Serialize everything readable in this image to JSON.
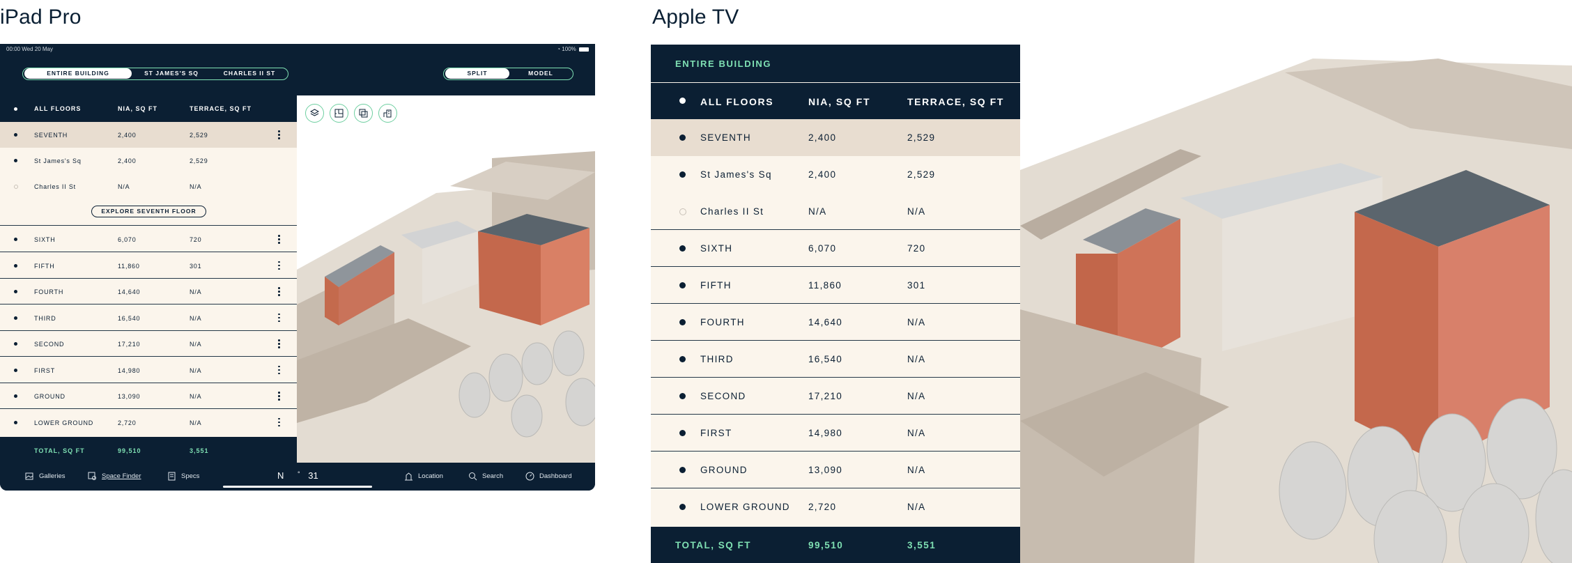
{
  "labels": {
    "ipad": "iPad Pro",
    "tv": "Apple TV"
  },
  "ipad": {
    "status": {
      "time": "00:00  Wed 20 May",
      "battery": "100%"
    },
    "building_tabs": [
      "ENTIRE BUILDING",
      "ST JAMES'S SQ",
      "CHARLES II ST"
    ],
    "active_building_tab": "ENTIRE BUILDING",
    "view_tabs": [
      "SPLIT",
      "MODEL"
    ],
    "active_view_tab": "SPLIT",
    "headers": {
      "floor": "ALL FLOORS",
      "nia": "NIA, SQ FT",
      "terrace": "TERRACE, SQ FT"
    },
    "seventh": {
      "floor": "SEVENTH",
      "nia": "2,400",
      "terrace": "2,529"
    },
    "sub_rows": [
      {
        "floor": "St James's Sq",
        "nia": "2,400",
        "terrace": "2,529"
      },
      {
        "floor": "Charles II St",
        "nia": "N/A",
        "terrace": "N/A"
      }
    ],
    "explore_button": "EXPLORE SEVENTH FLOOR",
    "rows": [
      {
        "floor": "SIXTH",
        "nia": "6,070",
        "terrace": "720"
      },
      {
        "floor": "FIFTH",
        "nia": "11,860",
        "terrace": "301"
      },
      {
        "floor": "FOURTH",
        "nia": "14,640",
        "terrace": "N/A"
      },
      {
        "floor": "THIRD",
        "nia": "16,540",
        "terrace": "N/A"
      },
      {
        "floor": "SECOND",
        "nia": "17,210",
        "terrace": "N/A"
      },
      {
        "floor": "FIRST",
        "nia": "14,980",
        "terrace": "N/A"
      },
      {
        "floor": "GROUND",
        "nia": "13,090",
        "terrace": "N/A"
      },
      {
        "floor": "LOWER GROUND",
        "nia": "2,720",
        "terrace": "N/A"
      }
    ],
    "total": {
      "label": "TOTAL, SQ FT",
      "nia": "99,510",
      "terrace": "3,551"
    },
    "tools": [
      "layers-icon",
      "floorplan-icon",
      "copy-icon",
      "building-icon"
    ],
    "tabbar": {
      "galleries": "Galleries",
      "space_finder": "Space Finder",
      "specs": "Specs",
      "compass_dir": "N",
      "compass_val": "31",
      "location": "Location",
      "search": "Search",
      "dashboard": "Dashboard"
    }
  },
  "tv": {
    "top": "ENTIRE BUILDING",
    "headers": {
      "floor": "ALL FLOORS",
      "nia": "NIA, SQ FT",
      "terrace": "TERRACE, SQ FT"
    },
    "rows": [
      {
        "floor": "SEVENTH",
        "nia": "2,400",
        "terrace": "2,529"
      },
      {
        "floor": "St James's Sq",
        "nia": "2,400",
        "terrace": "2,529"
      },
      {
        "floor": "Charles II St",
        "nia": "N/A",
        "terrace": "N/A"
      },
      {
        "floor": "SIXTH",
        "nia": "6,070",
        "terrace": "720"
      },
      {
        "floor": "FIFTH",
        "nia": "11,860",
        "terrace": "301"
      },
      {
        "floor": "FOURTH",
        "nia": "14,640",
        "terrace": "N/A"
      },
      {
        "floor": "THIRD",
        "nia": "16,540",
        "terrace": "N/A"
      },
      {
        "floor": "SECOND",
        "nia": "17,210",
        "terrace": "N/A"
      },
      {
        "floor": "FIRST",
        "nia": "14,980",
        "terrace": "N/A"
      },
      {
        "floor": "GROUND",
        "nia": "13,090",
        "terrace": "N/A"
      },
      {
        "floor": "LOWER GROUND",
        "nia": "2,720",
        "terrace": "N/A"
      }
    ],
    "total": {
      "label": "TOTAL, SQ FT",
      "nia": "99,510",
      "terrace": "3,551"
    }
  },
  "colors": {
    "navy": "#0b1f33",
    "cream": "#fbf5ec",
    "selected": "#e8ddd0",
    "accent": "#7fe0b3"
  }
}
